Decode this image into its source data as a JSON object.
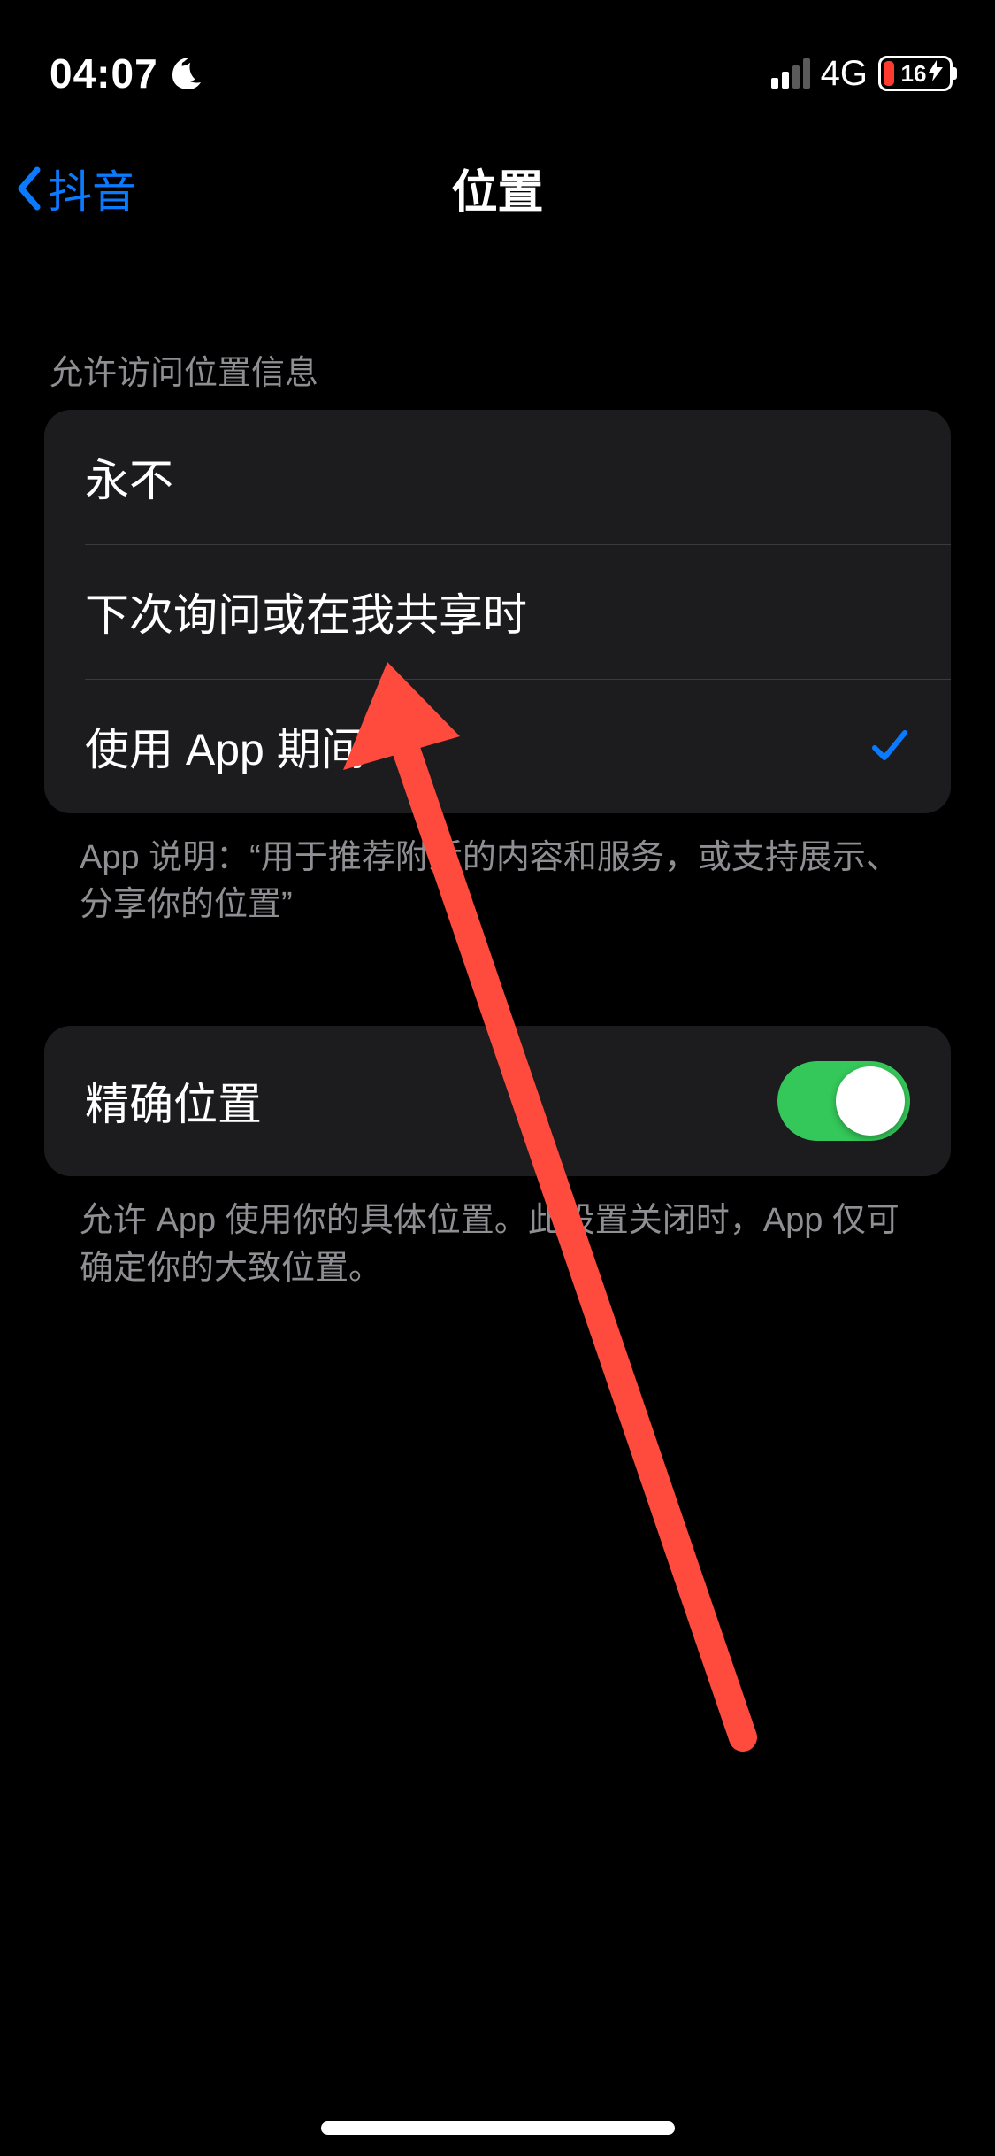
{
  "statusbar": {
    "time": "04:07",
    "network": "4G",
    "battery_percent": "16"
  },
  "nav": {
    "back_label": "抖音",
    "title": "位置"
  },
  "location_access": {
    "header": "允许访问位置信息",
    "options": [
      {
        "label": "永不",
        "selected": false
      },
      {
        "label": "下次询问或在我共享时",
        "selected": false
      },
      {
        "label": "使用 App 期间",
        "selected": true
      }
    ],
    "footer": "App 说明：“用于推荐附近的内容和服务，或支持展示、分享你的位置”"
  },
  "precise": {
    "label": "精确位置",
    "enabled": true,
    "footer": "允许 App 使用你的具体位置。此设置关闭时，App 仅可确定你的大致位置。"
  }
}
